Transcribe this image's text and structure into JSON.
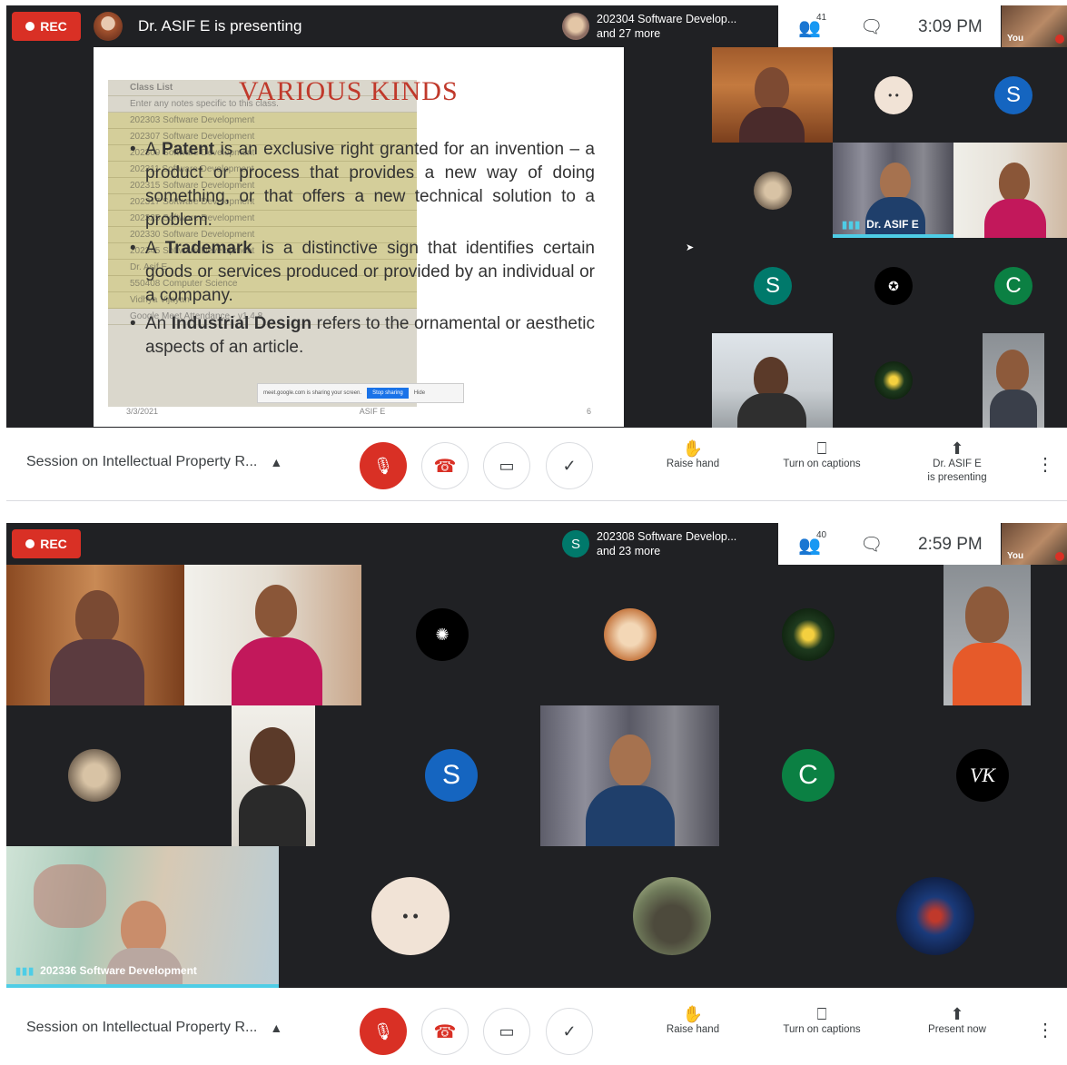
{
  "top": {
    "rec_label": "REC",
    "presenter_text": "Dr. ASIF E is presenting",
    "participant_line1": "202304 Software Develop...",
    "participant_line2": "and 27 more",
    "people_count": "41",
    "clock": "3:09 PM",
    "self_label": "You"
  },
  "slide": {
    "title": "VARIOUS KINDS",
    "b1_pre": "A ",
    "b1_bold": "Patent",
    "b1_post": " is an exclusive right granted for an invention – a product or process that provides a new way of doing something, or that offers a new technical solution to a problem.",
    "b2_pre": "A ",
    "b2_bold": "Trademark",
    "b2_post": " is a distinctive sign that identifies certain goods or services produced or provided by an individual or a company.",
    "b3_pre": "An ",
    "b3_bold": "Industrial Design",
    "b3_post": " refers to the ornamental or aesthetic aspects of an article.",
    "footer_date": "3/3/2021",
    "footer_author": "ASIF E",
    "footer_page": "6",
    "overlay_title": "Class List",
    "overlay_note": "Enter any notes specific to this class.",
    "overlay_rows": [
      "202303 Software Development",
      "202307 Software Development",
      "202309 Software Development",
      "202311 Software Development",
      "202315 Software Development",
      "202317 Software Development",
      "202325 Software Development",
      "202330 Software Development",
      "202345 Software Development",
      "Dr. Asif E",
      "550408 Computer Science",
      "Vidhya Vijayan"
    ],
    "overlay_footer": "Google Meet Attendance - v1.4.8",
    "share_text": "meet.google.com is sharing your screen.",
    "share_stop": "Stop sharing",
    "share_hide": "Hide"
  },
  "grid1": {
    "speaker_name": "Dr. ASIF E",
    "s_letter": "S",
    "c_letter": "C"
  },
  "controls1": {
    "meeting_title": "Session on Intellectual Property R...",
    "raise_hand": "Raise hand",
    "captions": "Turn on captions",
    "present_line1": "Dr. ASIF E",
    "present_line2": "is presenting"
  },
  "top2": {
    "rec_label": "REC",
    "participant_initial": "S",
    "participant_line1": "202308 Software Develop...",
    "participant_line2": "and 23 more",
    "people_count": "40",
    "clock": "2:59 PM",
    "self_label": "You"
  },
  "grid2": {
    "s_letter": "S",
    "c_letter": "C",
    "vk_label": "VK",
    "speaker_name": "202336 Software Development"
  },
  "controls2": {
    "meeting_title": "Session on Intellectual Property R...",
    "raise_hand": "Raise hand",
    "captions": "Turn on captions",
    "present": "Present now"
  },
  "colors": {
    "accent": "#4ecde6",
    "rec": "#d93025",
    "meet_bg": "#202124",
    "avatar_blue": "#1565c0",
    "avatar_green": "#0b8043",
    "avatar_teal": "#00796b"
  }
}
